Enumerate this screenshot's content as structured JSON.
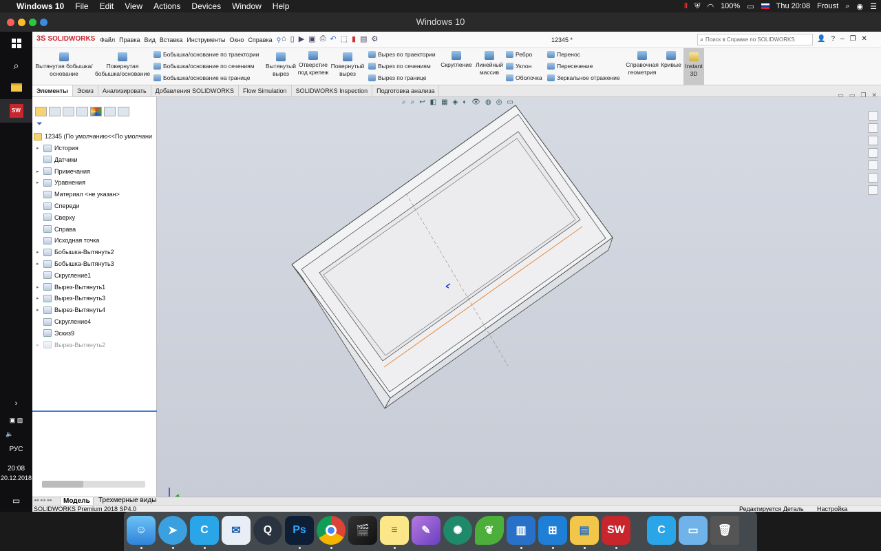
{
  "mac_menubar": {
    "app": "Windows 10",
    "menus": [
      "File",
      "Edit",
      "View",
      "Actions",
      "Devices",
      "Window",
      "Help"
    ],
    "battery": "100%",
    "clock": "Thu 20:08",
    "user": "Froust"
  },
  "window_title": "Windows 10",
  "taskbar": {
    "lang": "РУС",
    "time": "20:08",
    "date": "20.12.2018"
  },
  "sw": {
    "logo": "SOLIDWORKS",
    "menus": [
      "Файл",
      "Правка",
      "Вид",
      "Вставка",
      "Инструменты",
      "Окно",
      "Справка"
    ],
    "doc_title": "12345 *",
    "search_placeholder": "Поиск в Справке по SOLIDWORKS",
    "ribbon": {
      "extrude_boss": "Вытянутая бобышка/основание",
      "revolve_boss": "Повернутая бобышка/основание",
      "sweep_boss": "Бобышка/основание по траектории",
      "loft_boss": "Бобышка/основание по сечениям",
      "boundary_boss": "Бобышка/основание на границе",
      "extruded_cut": "Вытянутый вырез",
      "hole_wizard": "Отверстие под крепеж",
      "revolved_cut": "Повернутый вырез",
      "swept_cut": "Вырез по траектории",
      "lofted_cut": "Вырез по сечениям",
      "boundary_cut": "Вырез по границе",
      "fillet": "Скругление",
      "linear_pattern": "Линейный массив",
      "rib": "Ребро",
      "draft": "Уклон",
      "shell": "Оболочка",
      "wrap": "Перенос",
      "intersect": "Пересечение",
      "mirror": "Зеркальное отражение",
      "ref_geometry": "Справочная геометрия",
      "curves": "Кривые",
      "instant3d": "Instant 3D"
    },
    "tabs": [
      "Элементы",
      "Эскиз",
      "Анализировать",
      "Добавления SOLIDWORKS",
      "Flow Simulation",
      "SOLIDWORKS Inspection",
      "Подготовка анализа"
    ],
    "tree": {
      "root": "12345  (По умолчанию<<По умолчани",
      "items": [
        {
          "label": "История",
          "expand": true
        },
        {
          "label": "Датчики",
          "expand": false
        },
        {
          "label": "Примечания",
          "expand": true
        },
        {
          "label": "Уравнения",
          "expand": true
        },
        {
          "label": "Материал <не указан>",
          "expand": false
        },
        {
          "label": "Спереди",
          "expand": false
        },
        {
          "label": "Сверху",
          "expand": false
        },
        {
          "label": "Справа",
          "expand": false
        },
        {
          "label": "Исходная точка",
          "expand": false
        },
        {
          "label": "Бобышка-Вытянуть2",
          "expand": true
        },
        {
          "label": "Бобышка-Вытянуть3",
          "expand": true
        },
        {
          "label": "Скругление1",
          "expand": false
        },
        {
          "label": "Вырез-Вытянуть1",
          "expand": true
        },
        {
          "label": "Вырез-Вытянуть3",
          "expand": true
        },
        {
          "label": "Вырез-Вытянуть4",
          "expand": true
        },
        {
          "label": "Скругление4",
          "expand": false
        },
        {
          "label": "Эскиз9",
          "expand": false
        },
        {
          "label": "Вырез-Вытянуть2",
          "expand": true
        }
      ]
    },
    "bottom_tabs": [
      "Модель",
      "Трехмерные виды"
    ],
    "status_left": "SOLIDWORKS Premium 2018 SP4.0",
    "status_mode": "Редактируется Деталь",
    "status_custom": "Настройка"
  },
  "dock": {
    "icons": [
      "finder-icon",
      "telegram-icon",
      "cortex-icon",
      "mail-icon",
      "quicktime-icon",
      "photoshop-icon",
      "chrome-icon",
      "final-cut-icon",
      "notes-icon",
      "feather-icon",
      "palm-icon",
      "leaf-icon",
      "windows-vm-icon",
      "windows-icon",
      "explorer-icon",
      "solidworks-icon",
      "cortex2-icon",
      "folder-icon",
      "trash-icon"
    ],
    "ps_label": "Ps",
    "sw_label": "SW"
  }
}
